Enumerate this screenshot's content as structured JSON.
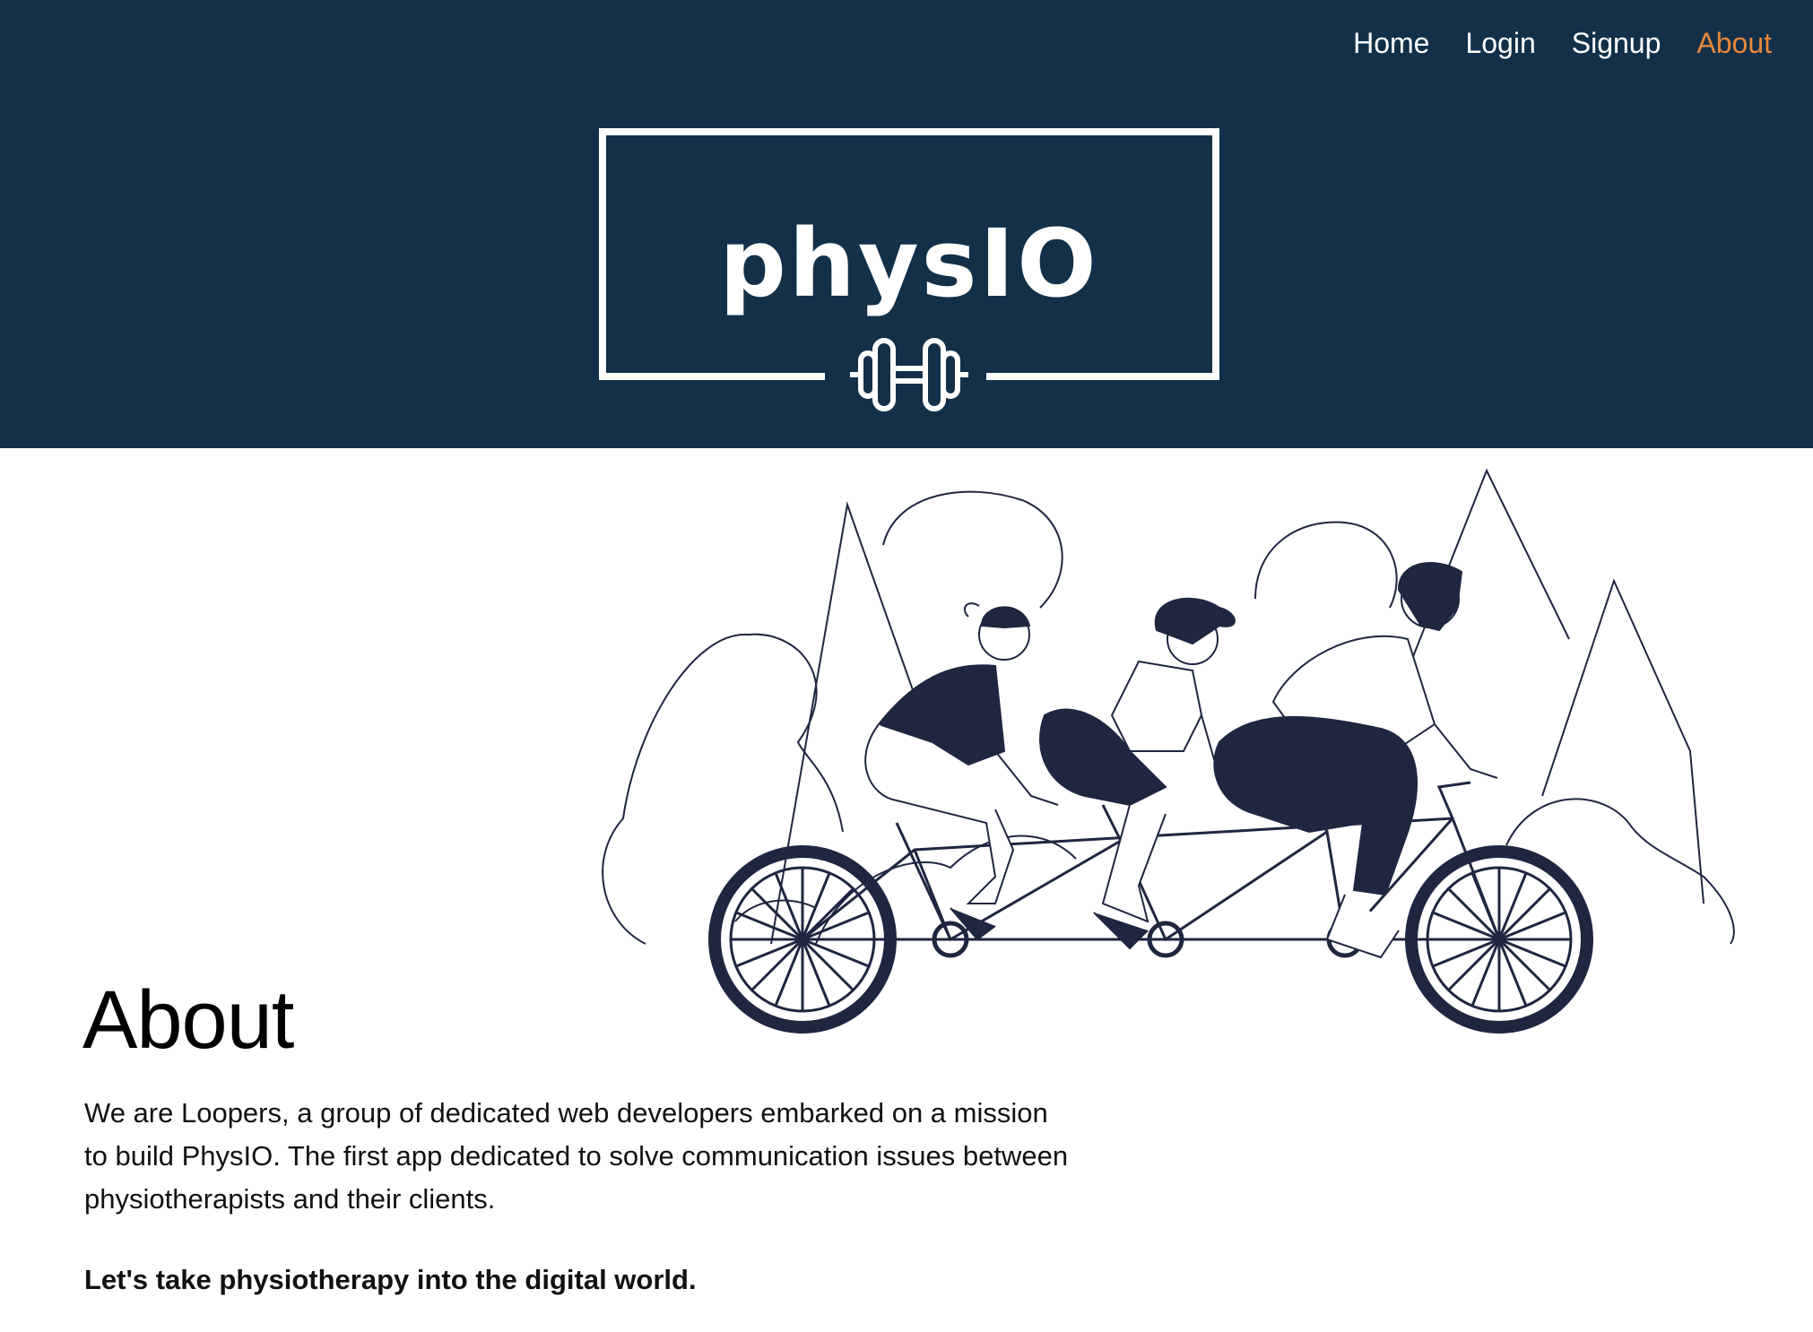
{
  "nav": {
    "items": [
      {
        "label": "Home",
        "active": false
      },
      {
        "label": "Login",
        "active": false
      },
      {
        "label": "Signup",
        "active": false
      },
      {
        "label": "About",
        "active": true
      }
    ]
  },
  "logo": {
    "text": "physIO",
    "icon": "dumbbell-icon"
  },
  "illustration": {
    "icon": "tandem-bicycle-illustration"
  },
  "about": {
    "title": "About",
    "paragraph": "We are Loopers, a group of dedicated web developers embarked on a mission to build PhysIO. The first app dedicated to solve communication issues between physiotherapists and their clients.",
    "tagline": "Let's take physiotherapy into the digital world."
  },
  "colors": {
    "header_bg": "#133048",
    "nav_active": "#e8883a",
    "nav_text": "#ffffff",
    "illustration_ink": "#1f2640"
  }
}
